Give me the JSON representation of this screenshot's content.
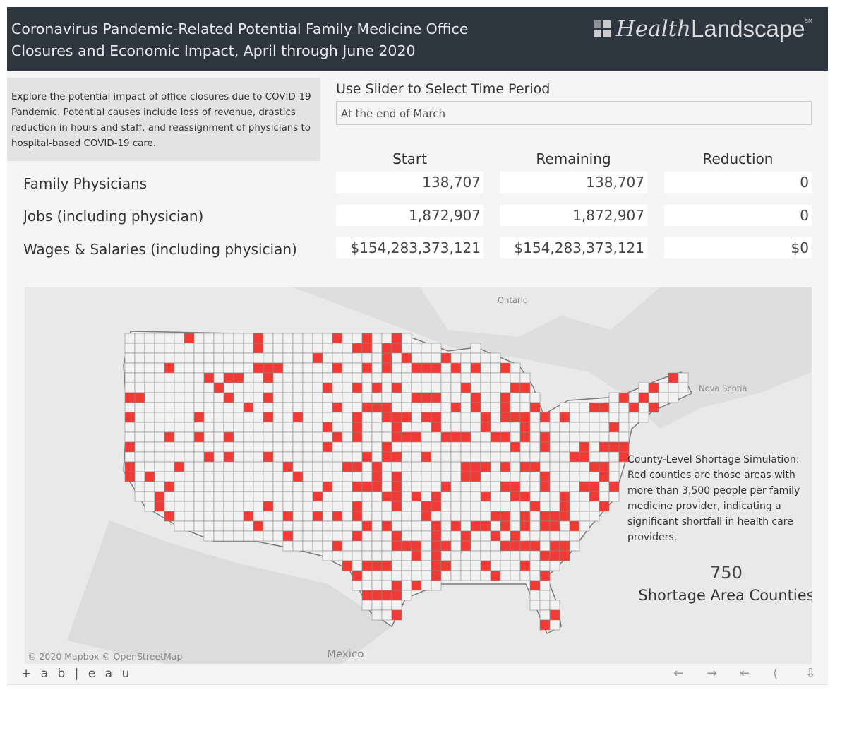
{
  "header": {
    "title_line1": "Coronavirus Pandemic-Related Potential Family Medicine Office",
    "title_line2": "Closures and Economic Impact, April through June 2020",
    "logo_part1": "Health",
    "logo_part2": "Landscape",
    "logo_mark": "SM"
  },
  "description": "Explore the potential impact of office closures due to COVID-19 Pandemic.  Potential causes include loss of revenue, drastics reduction in hours and staff, and reassignment of physicians to hospital-based COVID-19 care.",
  "slider": {
    "label": "Use Slider to Select Time Period",
    "value": "At the end of March"
  },
  "table": {
    "columns": [
      "Start",
      "Remaining",
      "Reduction"
    ],
    "rows": [
      {
        "label": "Family Physicians",
        "values": [
          "138,707",
          "138,707",
          "0"
        ]
      },
      {
        "label": "Jobs (including physician)",
        "values": [
          "1,872,907",
          "1,872,907",
          "0"
        ]
      },
      {
        "label": "Wages & Salaries (including physician)",
        "values": [
          "$154,283,373,121",
          "$154,283,373,121",
          "$0"
        ]
      }
    ]
  },
  "map": {
    "labels": {
      "ontario": "Ontario",
      "nova_scotia": "Nova Scotia",
      "mexico": "Mexico"
    },
    "attribution": "© 2020 Mapbox  © OpenStreetMap",
    "legend": "County-Level Shortage Simulation: Red counties are those areas with more than 3,500 people per family medicine provider, indicating a significant shortfall in health care providers.",
    "count": "750",
    "count_label": "Shortage Area Counties",
    "shortage_color": "#f03a33",
    "county_color": "#f2f2f2"
  },
  "footer": {
    "brand": "+ a b | e a u",
    "icons": [
      "undo-icon",
      "redo-icon",
      "revert-icon",
      "share-icon",
      "download-icon"
    ]
  }
}
